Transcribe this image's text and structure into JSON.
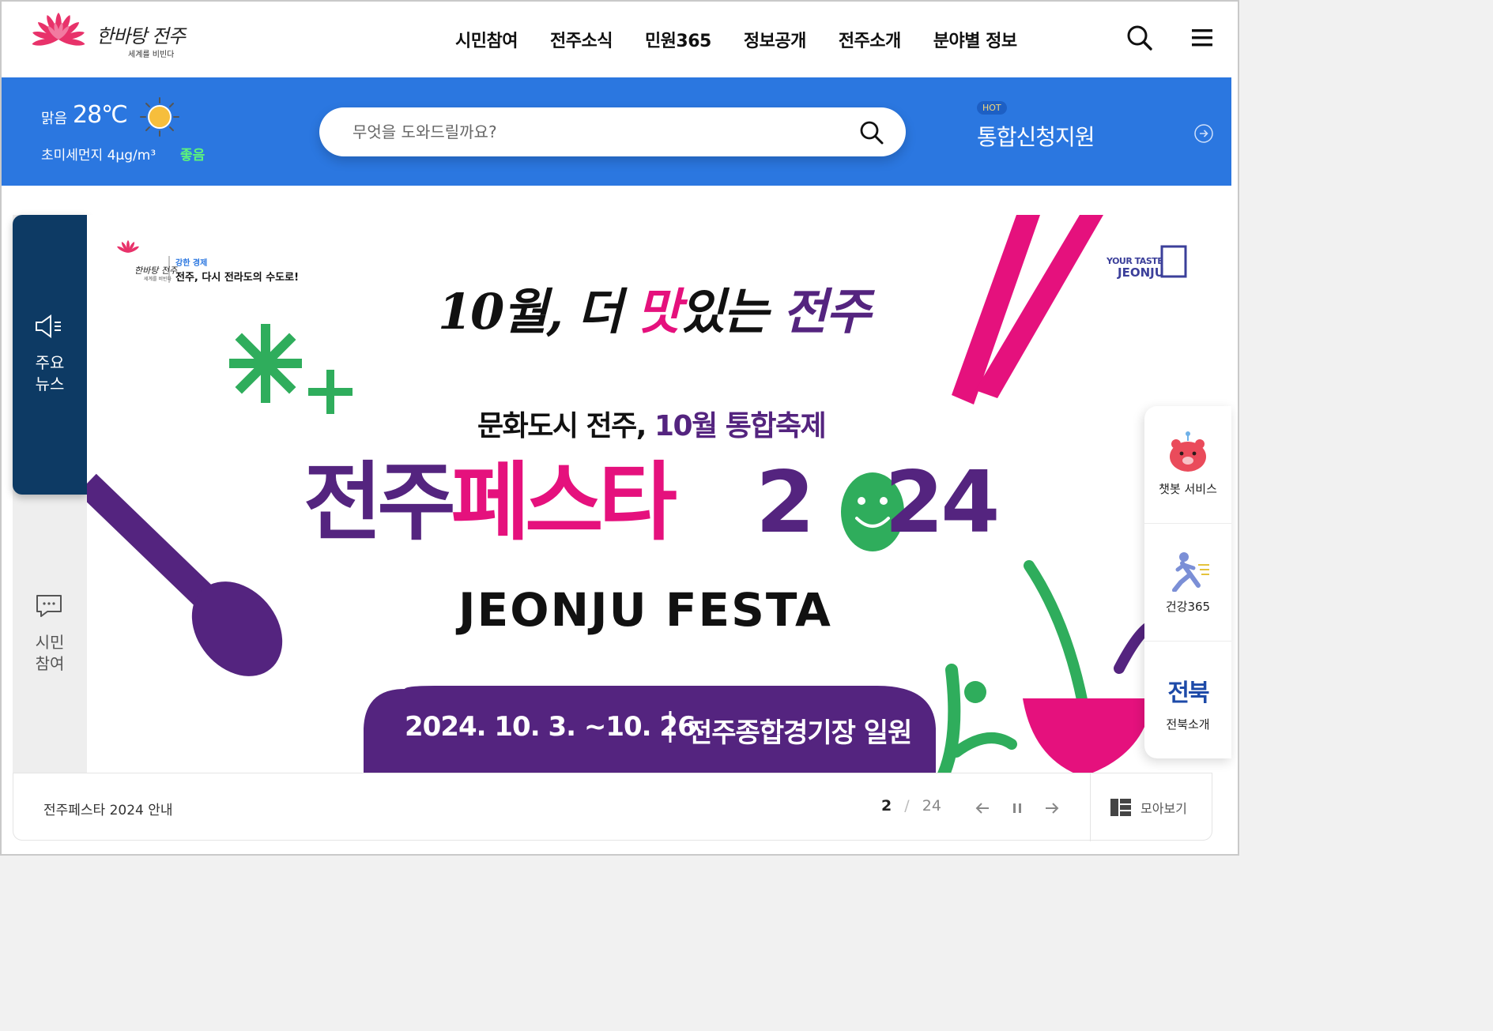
{
  "header": {
    "logo": {
      "main": "한바탕 전주",
      "sub": "세계를 비빈다"
    },
    "nav": [
      "시민참여",
      "전주소식",
      "민원365",
      "정보공개",
      "전주소개",
      "분야별 정보"
    ],
    "icons": [
      "search-icon",
      "menu-icon"
    ]
  },
  "weather": {
    "condition": "맑음",
    "temperature": "28℃",
    "dust_label": "초미세먼지 4μg/m³",
    "dust_status": "좋음",
    "dust_status_color": "#5df57a"
  },
  "search": {
    "placeholder": "무엇을 도와드릴까요?"
  },
  "hot": {
    "badge": "HOT",
    "title": "통합신청지원"
  },
  "left_nav": [
    {
      "label_line1": "주요",
      "label_line2": "뉴스",
      "active": true,
      "icon": "megaphone-icon"
    },
    {
      "label_line1": "시민",
      "label_line2": "참여",
      "active": false,
      "icon": "chat-icon"
    }
  ],
  "banner": {
    "logo_main": "한바탕 전주",
    "logo_sub": "세계를 비빈다",
    "slogan_small": "강한 경제",
    "slogan": "전주, 다시 전라도의 수도로!",
    "brand_top": "YOUR TASTE",
    "brand_bottom": "JEONJU",
    "handwrite_a": "10월, 더 ",
    "handwrite_b": "맛",
    "handwrite_c": "있는 ",
    "handwrite_d": "전주",
    "sub_a": "문화도시 전주, ",
    "sub_b": "10월 통합축제",
    "title_a": "전주",
    "title_b": "페스타",
    "title_c": "2",
    "title_d": "24",
    "english": "JEONJU FESTA",
    "dates": "2024. 10. 3. ~10. 26.",
    "venue": "전주종합경기장 일원",
    "colors": {
      "purple": "#54247f",
      "pink": "#e5117d",
      "green": "#2fad5c",
      "navy": "#0d3a64"
    }
  },
  "caption": {
    "title": "전주페스타 2024 안내",
    "current": "2",
    "separator": "/",
    "total": "24",
    "view_all": "모아보기"
  },
  "quick_menu": [
    {
      "label": "챗봇 서비스",
      "icon": "chatbot-icon"
    },
    {
      "label": "건강365",
      "icon": "running-person-icon"
    },
    {
      "label": "전북소개",
      "icon": "jeonbuk-logo",
      "logo_text": "전북"
    }
  ]
}
